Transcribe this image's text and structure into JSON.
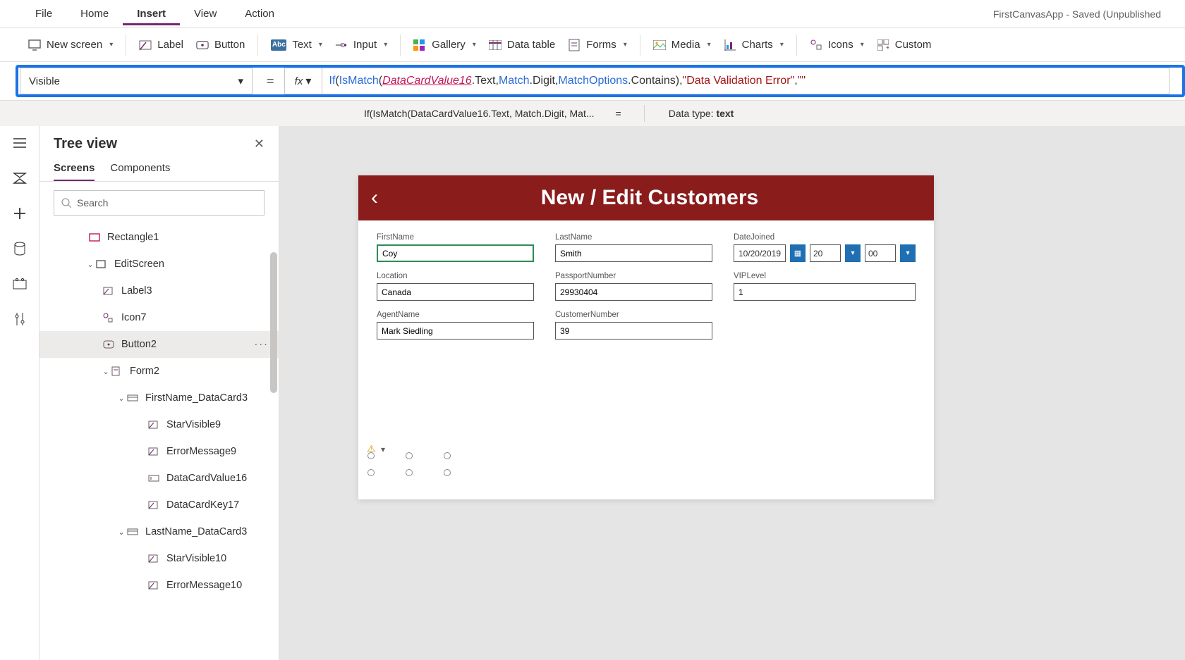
{
  "menubar": {
    "items": [
      "File",
      "Home",
      "Insert",
      "View",
      "Action"
    ],
    "active_index": 2,
    "app_title": "FirstCanvasApp - Saved (Unpublished"
  },
  "ribbon": {
    "new_screen": "New screen",
    "label": "Label",
    "button": "Button",
    "text": "Text",
    "input": "Input",
    "gallery": "Gallery",
    "data_table": "Data table",
    "forms": "Forms",
    "media": "Media",
    "charts": "Charts",
    "icons": "Icons",
    "custom": "Custom"
  },
  "formula": {
    "property": "Visible",
    "preview": "If(IsMatch(DataCardValue16.Text, Match.Digit, Mat...",
    "datatype_label": "Data type:",
    "datatype_value": "text",
    "tokens": {
      "if": "If",
      "ismatch": "IsMatch",
      "id": "DataCardValue16",
      "prop": ".Text",
      "match": "Match",
      "digit": ".Digit",
      "matchopt": "MatchOptions",
      "contains": ".Contains",
      "str": "\"Data Validation Error\"",
      "str2": "\"\""
    }
  },
  "treeview": {
    "title": "Tree view",
    "tabs": [
      "Screens",
      "Components"
    ],
    "search_placeholder": "Search",
    "nodes": [
      {
        "label": "Rectangle1",
        "icon": "rect",
        "indent": "ind0"
      },
      {
        "label": "EditScreen",
        "icon": "screen",
        "indent": "ind1",
        "caret": true
      },
      {
        "label": "Label3",
        "icon": "label",
        "indent": "ind1c"
      },
      {
        "label": "Icon7",
        "icon": "icon",
        "indent": "ind1c"
      },
      {
        "label": "Button2",
        "icon": "button",
        "indent": "ind1c",
        "selected": true,
        "more": true
      },
      {
        "label": "Form2",
        "icon": "form",
        "indent": "ind2",
        "caret": true
      },
      {
        "label": "FirstName_DataCard3",
        "icon": "card",
        "indent": "ind3",
        "caret": true
      },
      {
        "label": "StarVisible9",
        "icon": "label",
        "indent": "ind3c"
      },
      {
        "label": "ErrorMessage9",
        "icon": "label",
        "indent": "ind3c"
      },
      {
        "label": "DataCardValue16",
        "icon": "input",
        "indent": "ind3c"
      },
      {
        "label": "DataCardKey17",
        "icon": "label",
        "indent": "ind3c"
      },
      {
        "label": "LastName_DataCard3",
        "icon": "card",
        "indent": "ind3",
        "caret": true
      },
      {
        "label": "StarVisible10",
        "icon": "label",
        "indent": "ind3c"
      },
      {
        "label": "ErrorMessage10",
        "icon": "label",
        "indent": "ind3c"
      }
    ]
  },
  "canvasapp": {
    "header": "New / Edit Customers",
    "fields": {
      "firstname": {
        "label": "FirstName",
        "value": "Coy"
      },
      "lastname": {
        "label": "LastName",
        "value": "Smith"
      },
      "datejoined": {
        "label": "DateJoined",
        "value": "10/20/2019",
        "hour": "20",
        "minute": "00"
      },
      "location": {
        "label": "Location",
        "value": "Canada"
      },
      "passport": {
        "label": "PassportNumber",
        "value": "29930404"
      },
      "viplevel": {
        "label": "VIPLevel",
        "value": "1"
      },
      "agentname": {
        "label": "AgentName",
        "value": "Mark Siedling"
      },
      "custnum": {
        "label": "CustomerNumber",
        "value": "39"
      }
    }
  }
}
